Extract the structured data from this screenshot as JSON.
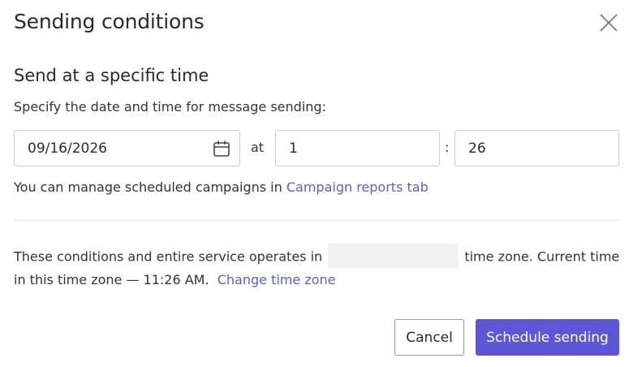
{
  "dialog": {
    "title": "Sending conditions",
    "close_icon": "close-icon"
  },
  "section": {
    "title": "Send at a specific time",
    "hint": "Specify the date and time for message sending:"
  },
  "schedule": {
    "date_value": "09/16/2026",
    "calendar_icon": "calendar-icon",
    "at_label": "at",
    "hour_value": "1",
    "colon": ":",
    "minute_value": "26"
  },
  "manage": {
    "text": "You can manage scheduled campaigns in ",
    "link": "Campaign reports tab"
  },
  "timezone": {
    "text_before": "These conditions and entire service operates in ",
    "text_after": " time zone. Current time in this time zone — 11:26 AM.",
    "change_link": "Change time zone"
  },
  "buttons": {
    "cancel": "Cancel",
    "schedule": "Schedule sending"
  },
  "colors": {
    "accent": "#5b57d6",
    "link": "#5b5fc7"
  }
}
